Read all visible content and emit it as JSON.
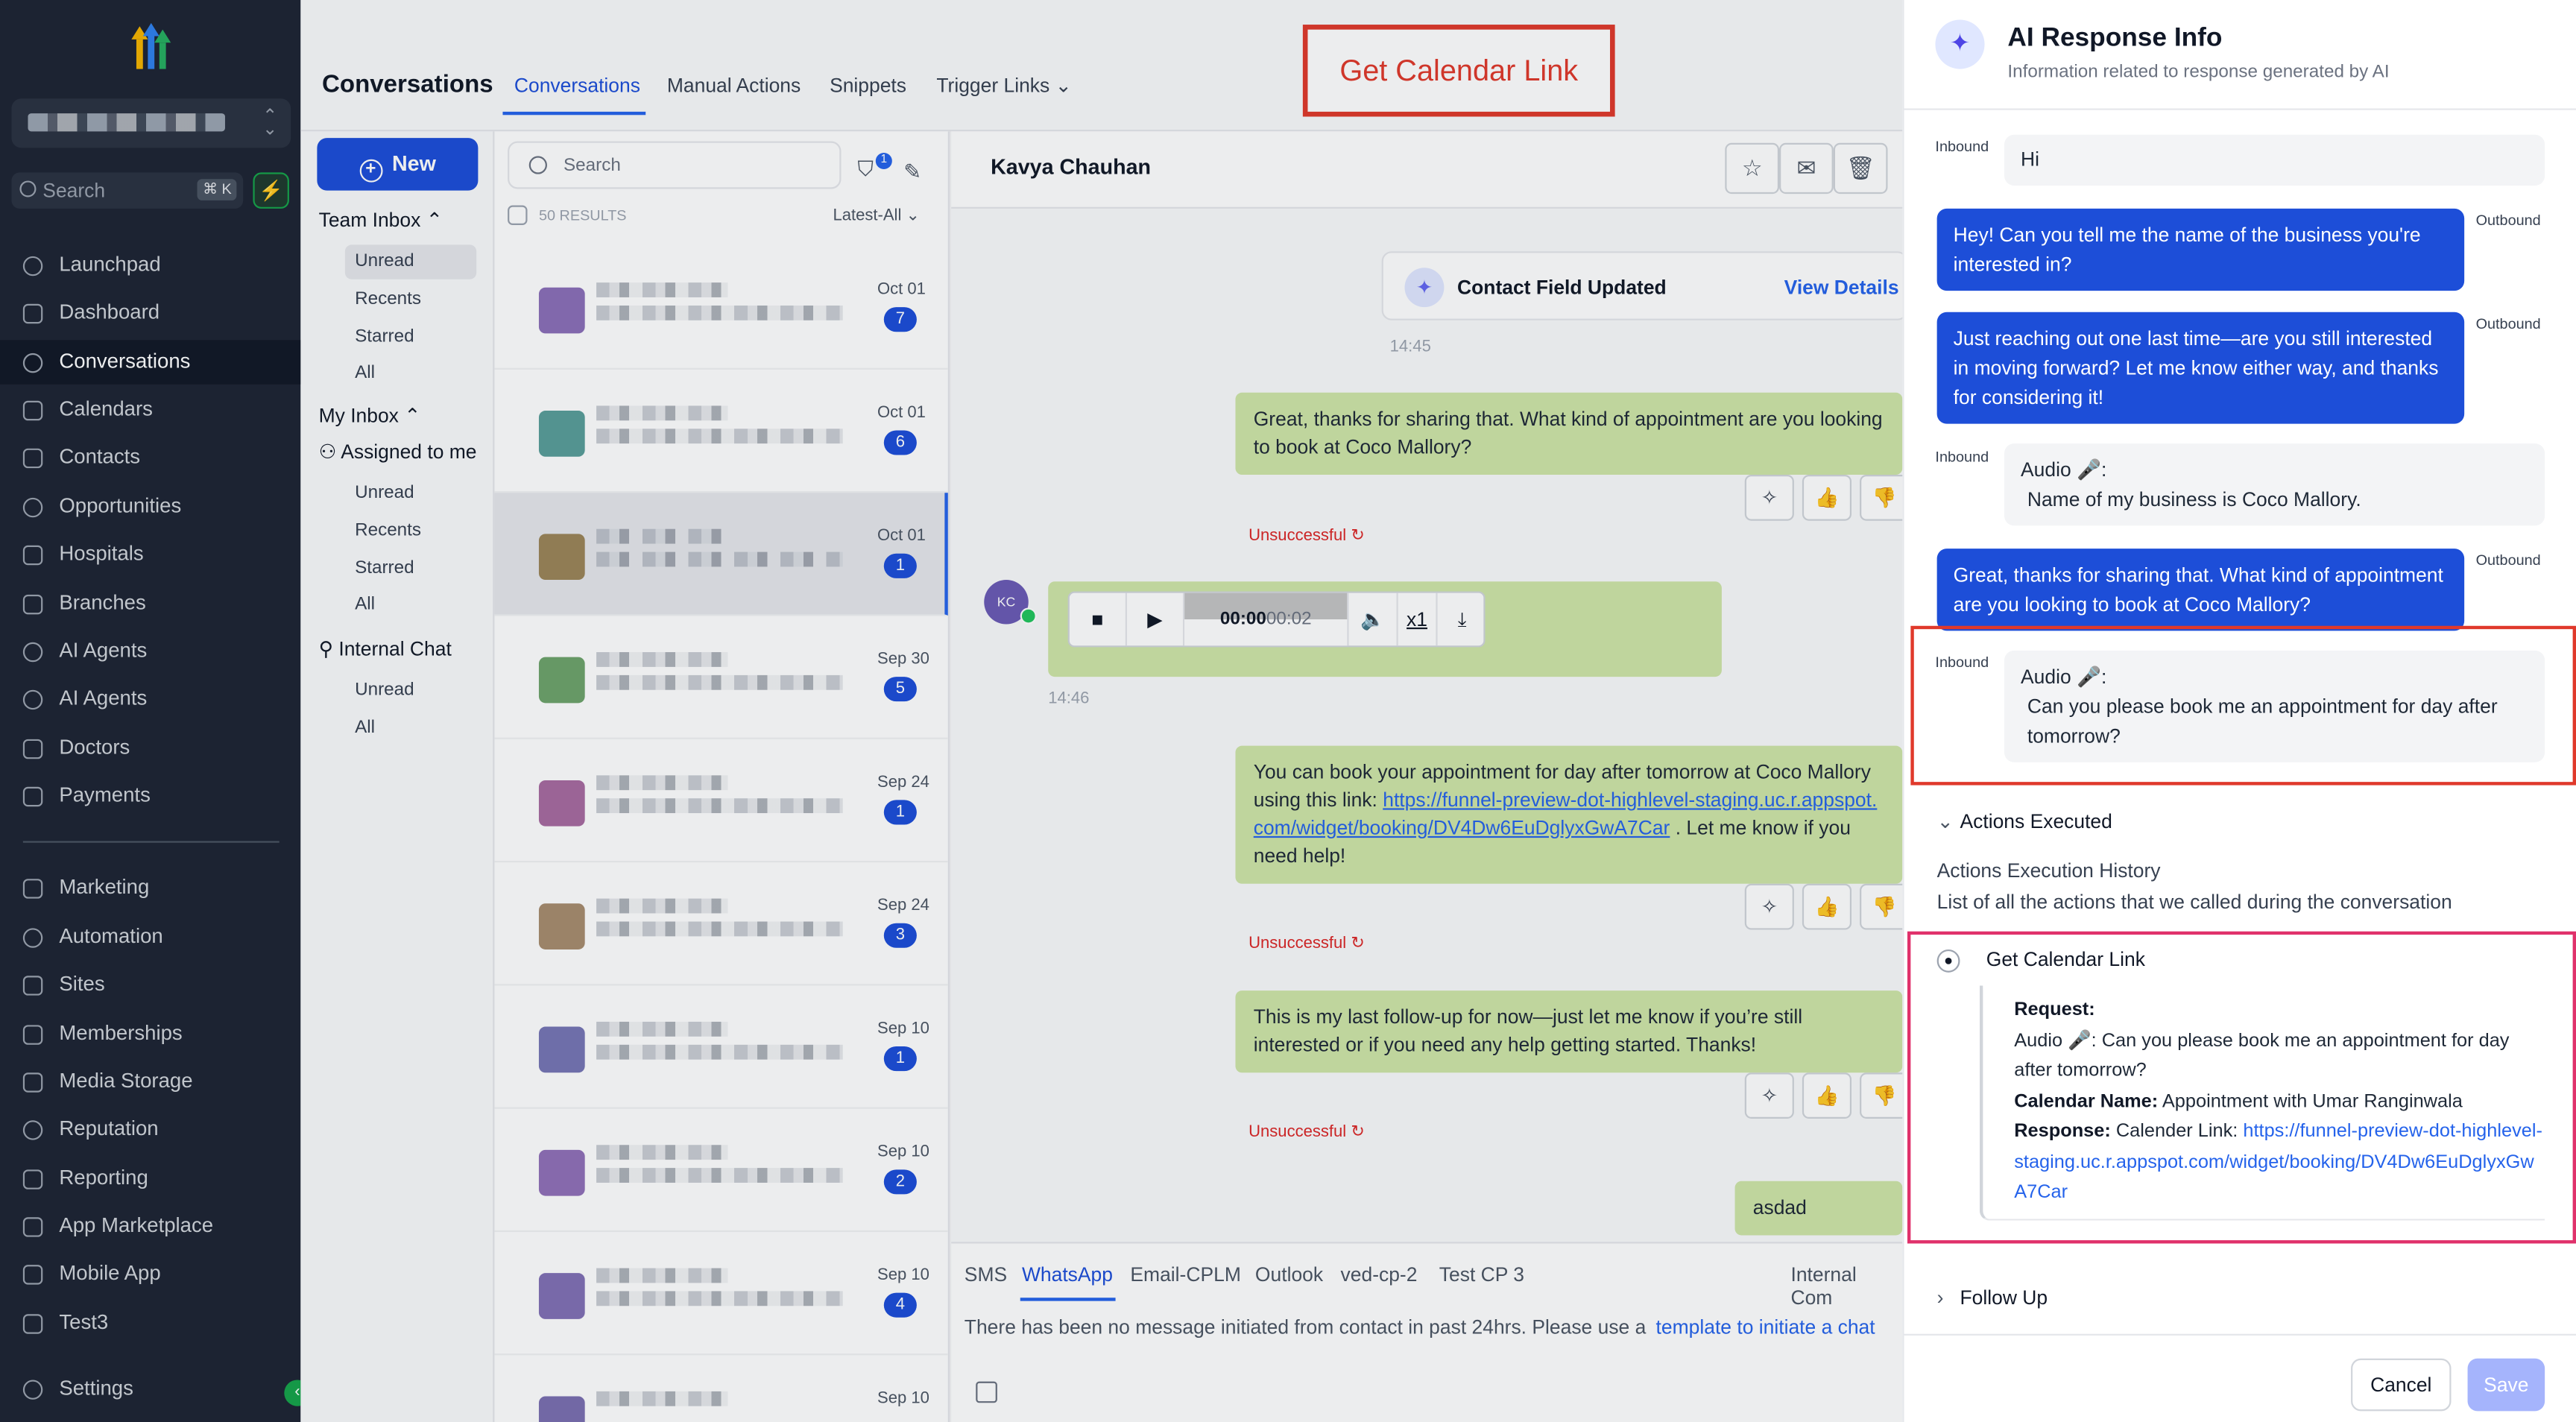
{
  "sidebar": {
    "search_placeholder": "Search",
    "search_shortcut": "⌘ K",
    "items": [
      {
        "label": "Launchpad"
      },
      {
        "label": "Dashboard"
      },
      {
        "label": "Conversations"
      },
      {
        "label": "Calendars"
      },
      {
        "label": "Contacts"
      },
      {
        "label": "Opportunities"
      },
      {
        "label": "Hospitals"
      },
      {
        "label": "Branches"
      },
      {
        "label": "AI Agents"
      },
      {
        "label": "AI Agents"
      },
      {
        "label": "Doctors"
      },
      {
        "label": "Payments"
      },
      {
        "label": "Marketing"
      },
      {
        "label": "Automation"
      },
      {
        "label": "Sites"
      },
      {
        "label": "Memberships"
      },
      {
        "label": "Media Storage"
      },
      {
        "label": "Reputation"
      },
      {
        "label": "Reporting"
      },
      {
        "label": "App Marketplace"
      },
      {
        "label": "Mobile App"
      },
      {
        "label": "Test3"
      },
      {
        "label": "Settings"
      }
    ]
  },
  "topbar": {
    "title": "Conversations",
    "tabs": [
      "Conversations",
      "Manual Actions",
      "Snippets",
      "Trigger Links"
    ],
    "annotation": "Get Calendar Link"
  },
  "inbox": {
    "new_label": "New",
    "team_inbox": "Team Inbox",
    "team_items": [
      "Unread",
      "Recents",
      "Starred",
      "All"
    ],
    "my_inbox": "My Inbox",
    "assigned": "Assigned to me",
    "my_items": [
      "Unread",
      "Recents",
      "Starred",
      "All"
    ],
    "internal_chat": "Internal Chat",
    "internal_items": [
      "Unread",
      "All"
    ]
  },
  "conv_list": {
    "search_placeholder": "Search",
    "filter_badge": "1",
    "results": "50 RESULTS",
    "sort": "Latest-All",
    "rows": [
      {
        "date": "Oct 01",
        "count": "7"
      },
      {
        "date": "Oct 01",
        "count": "6"
      },
      {
        "date": "Oct 01",
        "count": "1"
      },
      {
        "date": "Sep 30",
        "count": "5"
      },
      {
        "date": "Sep 24",
        "count": "1"
      },
      {
        "date": "Sep 24",
        "count": "3"
      },
      {
        "date": "Sep 10",
        "count": "1"
      },
      {
        "date": "Sep 10",
        "count": "2"
      },
      {
        "date": "Sep 10",
        "count": "4"
      },
      {
        "date": "Sep 10",
        "count": ""
      }
    ]
  },
  "chat": {
    "contact_name": "Kavya Chauhan",
    "event_title": "Contact Field Updated",
    "event_link": "View Details",
    "time1": "14:45",
    "msg1": "Great, thanks for sharing that. What kind of appointment are you looking to book at Coco Mallory?",
    "unsuccessful": "Unsuccessful",
    "avatar_initials": "KC",
    "audio_time_current": "00:00",
    "audio_time_total": "00:02",
    "audio_speed": "x1",
    "time2": "14:46",
    "msg2_pre": "You can book your appointment for day after tomorrow at Coco Mallory using this link:",
    "msg2_link": "https://funnel-preview-dot-highlevel-staging.uc.r.appspot.com/widget/booking/DV4Dw6EuDglyxGwA7Car",
    "msg2_post": ". Let me know if you need help!",
    "msg3": "This is my last follow-up for now—just let me know if you’re still interested or if you need any help getting started. Thanks!",
    "msg4": "asdad",
    "channels": [
      "SMS",
      "WhatsApp",
      "Email-CPLM",
      "Outlook",
      "ved-cp-2",
      "Test CP 3",
      "Internal Com"
    ],
    "notice": "There has been no message initiated from contact in past 24hrs. Please use a",
    "notice_link": "template to initiate a chat"
  },
  "panel": {
    "title": "AI Response Info",
    "subtitle": "Information related to response generated by AI",
    "inbound": "Inbound",
    "outbound": "Outbound",
    "m1": "Hi",
    "m2": "Hey! Can you tell me the name of the business you're interested in?",
    "m3": "Just reaching out one last time—are you still interested in moving forward? Let me know either way, and thanks for considering it!",
    "m4_head": "Audio 🎤:",
    "m4_body": "Name of my business is Coco Mallory.",
    "m5": "Great, thanks for sharing that. What kind of appointment are you looking to book at Coco Mallory?",
    "m6_head": "Audio 🎤:",
    "m6_body": "Can you please book me an appointment for day after tomorrow?",
    "actions_executed": "Actions Executed",
    "history_title": "Actions Execution History",
    "history_sub": "List of all the actions that we called during the conversation",
    "action_name": "Get Calendar Link",
    "request_label": "Request:",
    "request_text": "Audio 🎤: Can you please book me an appointment for day after tomorrow?",
    "calendar_label": "Calendar Name:",
    "calendar_text": "Appointment with Umar Ranginwala",
    "response_label": "Response:",
    "response_text": "Calender Link:",
    "response_link": "https://funnel-preview-dot-highlevel-staging.uc.r.appspot.com/widget/booking/DV4Dw6EuDglyxGwA7Car",
    "follow_up": "Follow Up",
    "cancel": "Cancel",
    "save": "Save"
  }
}
